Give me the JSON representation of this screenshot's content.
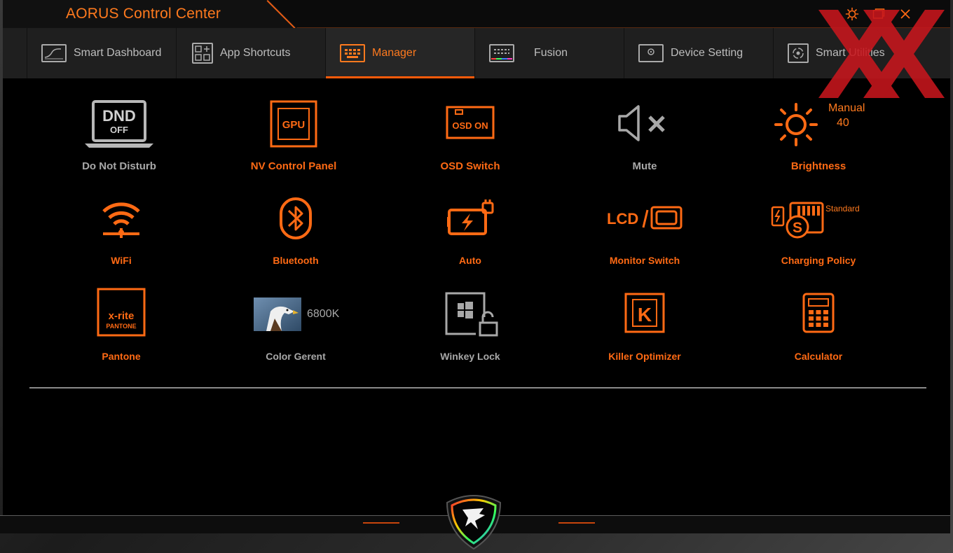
{
  "app": {
    "title": "AORUS Control Center"
  },
  "window_controls": {
    "settings_icon": "gear-icon",
    "maximize_icon": "maximize-icon",
    "close_icon": "close-icon"
  },
  "nav": {
    "tabs": [
      {
        "label": "Smart Dashboard",
        "icon": "dashboard-icon",
        "active": false
      },
      {
        "label": "App Shortcuts",
        "icon": "apps-grid-icon",
        "active": false
      },
      {
        "label": "Manager",
        "icon": "manager-keyboard-icon",
        "active": true
      },
      {
        "label": "Fusion",
        "icon": "keyboard-rgb-icon",
        "active": false
      },
      {
        "label": "Device Setting",
        "icon": "monitor-gear-icon",
        "active": false
      },
      {
        "label": "Smart Utilities",
        "icon": "smart-utilities-icon",
        "active": false
      }
    ]
  },
  "manager": {
    "items": [
      {
        "label": "Do Not Disturb",
        "icon": "dnd-laptop-icon",
        "icon_text": "DND",
        "icon_subtext": "OFF",
        "state": "off"
      },
      {
        "label": "NV Control Panel",
        "icon": "gpu-icon",
        "icon_text": "GPU",
        "state": "on"
      },
      {
        "label": "OSD Switch",
        "icon": "osd-icon",
        "icon_text": "OSD ON",
        "state": "on"
      },
      {
        "label": "Mute",
        "icon": "speaker-mute-icon",
        "state": "off"
      },
      {
        "label": "Brightness",
        "icon": "sun-icon",
        "mode": "Manual",
        "value": "40",
        "state": "on"
      },
      {
        "label": "WiFi",
        "icon": "wifi-icon",
        "state": "on"
      },
      {
        "label": "Bluetooth",
        "icon": "bluetooth-icon",
        "state": "on"
      },
      {
        "label": "Auto",
        "icon": "battery-plug-icon",
        "state": "on"
      },
      {
        "label": "Monitor Switch",
        "icon": "monitor-switch-icon",
        "icon_text": "LCD",
        "state": "on"
      },
      {
        "label": "Charging Policy",
        "icon": "charging-policy-icon",
        "icon_text": "S",
        "mode": "Standard",
        "state": "on"
      },
      {
        "label": "Pantone",
        "icon": "pantone-icon",
        "icon_text": "x-rite",
        "icon_subtext": "PANTONE",
        "state": "on"
      },
      {
        "label": "Color Gerent",
        "icon": "eagle-thumbnail-icon",
        "value": "6800K",
        "state": "off"
      },
      {
        "label": "Winkey Lock",
        "icon": "windows-lock-icon",
        "state": "off"
      },
      {
        "label": "Killer Optimizer",
        "icon": "killer-k-icon",
        "icon_text": "K",
        "state": "on"
      },
      {
        "label": "Calculator",
        "icon": "calculator-icon",
        "state": "on"
      }
    ]
  },
  "colors": {
    "accent": "#ff6a14",
    "inactive": "#a8a8a8",
    "background": "#000000"
  },
  "logo": "aorus-eagle-logo"
}
